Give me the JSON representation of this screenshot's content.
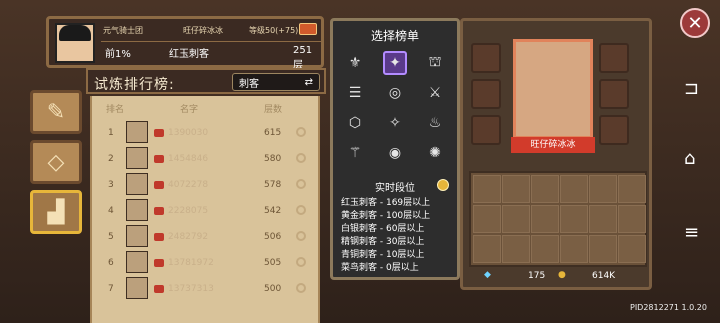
{
  "player_card": {
    "guild": "元气骑士团",
    "name": "旺仔碎冰冰",
    "level": "等级50(+75)",
    "rank_percent": "前1%",
    "tier": "红玉刺客",
    "floors": "251层"
  },
  "ranking": {
    "title": "试炼排行榜:",
    "class_selector": "刺客",
    "headers": {
      "rank": "排名",
      "name": "名字",
      "floors": "层数"
    },
    "rows": [
      {
        "rank": "1",
        "name": "1390030",
        "floors": "615"
      },
      {
        "rank": "2",
        "name": "1454846",
        "floors": "580"
      },
      {
        "rank": "3",
        "name": "4072278",
        "floors": "578"
      },
      {
        "rank": "4",
        "name": "2228075",
        "floors": "542"
      },
      {
        "rank": "5",
        "name": "2482792",
        "floors": "506"
      },
      {
        "rank": "6",
        "name": "13781972",
        "floors": "505"
      },
      {
        "rank": "7",
        "name": "13737313",
        "floors": "500"
      }
    ]
  },
  "select_menu": {
    "title": "选择榜单",
    "icons": [
      "knight-icon",
      "assassin-icon",
      "ranger-icon",
      "alchemist-icon",
      "engineer-icon",
      "vampire-icon",
      "paladin-icon",
      "elf-icon",
      "werewolf-icon",
      "priest-icon",
      "druid-icon",
      "berserker-icon"
    ],
    "realtime_title": "实时段位",
    "tiers": [
      "红玉刺客 - 169层以上",
      "黄金刺客 - 100层以上",
      "白银刺客 - 60层以上",
      "精钢刺客 - 30层以上",
      "青铜刺客 - 10层以上",
      "菜鸟刺客 - 0层以上"
    ]
  },
  "right_panel": {
    "character_name": "旺仔碎冰冰",
    "gems": "175",
    "gold": "614K"
  },
  "footer": {
    "pid": "PID2812271",
    "version": "1.0.20"
  },
  "colors": {
    "accent": "#d23b2b",
    "gold": "#e7b63a",
    "selected": "#5a3a8a"
  }
}
